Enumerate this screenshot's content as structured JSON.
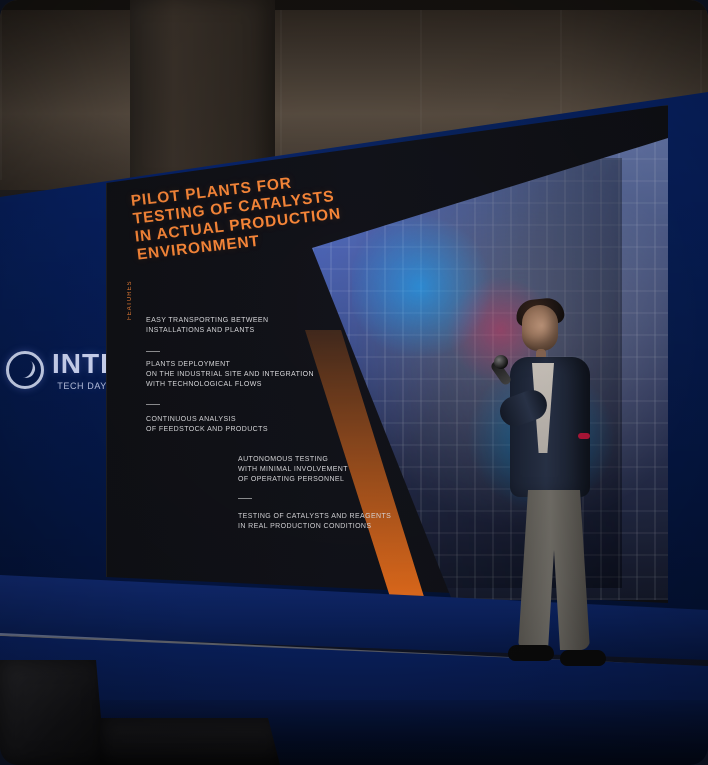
{
  "scene": {
    "logo": {
      "main": "INTI",
      "sub": "TECH DAY"
    },
    "slide": {
      "title": "PILOT PLANTS FOR TESTING OF CATALYSTS IN ACTUAL PRODUCTION ENVIRONMENT",
      "features_label": "FEATURES",
      "items": [
        "EASY TRANSPORTING BETWEEN\nINSTALLATIONS AND PLANTS",
        "PLANTS DEPLOYMENT\nON THE INDUSTRIAL SITE AND INTEGRATION\nWITH TECHNOLOGICAL FLOWS",
        "CONTINUOUS ANALYSIS\nOF FEEDSTOCK AND PRODUCTS",
        "AUTONOMOUS TESTING\nWITH MINIMAL INVOLVEMENT\nOF OPERATING PERSONNEL",
        "TESTING OF CATALYSTS AND REAGENTS\nIN REAL PRODUCTION CONDITIONS"
      ]
    },
    "colors": {
      "backdrop_blue": "#0a2f8d",
      "slide_orange": "#ff8a3a",
      "slide_text": "#e7e7ea"
    },
    "icons": {
      "logo_mark": "inti-logo-icon",
      "microphone": "microphone-icon"
    }
  }
}
